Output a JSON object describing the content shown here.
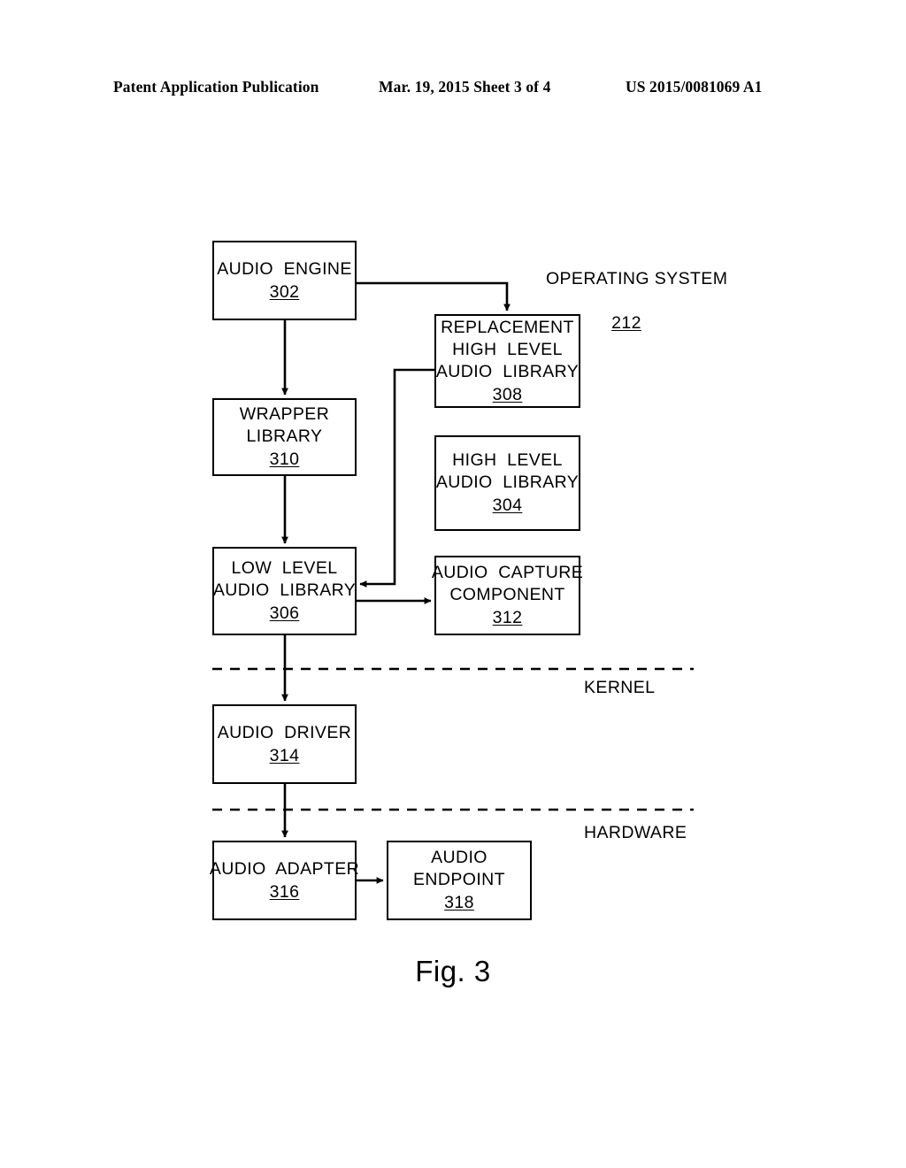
{
  "header": {
    "left": "Patent Application Publication",
    "middle": "Mar. 19, 2015  Sheet 3 of 4",
    "right": "US 2015/0081069 A1"
  },
  "figure": {
    "caption": "Fig. 3"
  },
  "diagram": {
    "operating_system_label": {
      "title": "OPERATING SYSTEM",
      "ref": "212"
    },
    "kernel_label": "KERNEL",
    "hardware_label": "HARDWARE",
    "nodes": [
      {
        "id": "audio-engine",
        "lines": [
          "AUDIO  ENGINE"
        ],
        "ref": "302"
      },
      {
        "id": "replacement-high-level",
        "lines": [
          "REPLACEMENT",
          "HIGH  LEVEL",
          "AUDIO  LIBRARY"
        ],
        "ref": "308"
      },
      {
        "id": "wrapper-library",
        "lines": [
          "WRAPPER",
          "LIBRARY"
        ],
        "ref": "310"
      },
      {
        "id": "high-level-audio",
        "lines": [
          "HIGH  LEVEL",
          "AUDIO  LIBRARY"
        ],
        "ref": "304"
      },
      {
        "id": "low-level-audio",
        "lines": [
          "LOW  LEVEL",
          "AUDIO  LIBRARY"
        ],
        "ref": "306"
      },
      {
        "id": "audio-capture",
        "lines": [
          "AUDIO  CAPTURE",
          "COMPONENT"
        ],
        "ref": "312"
      },
      {
        "id": "audio-driver",
        "lines": [
          "AUDIO  DRIVER"
        ],
        "ref": "314"
      },
      {
        "id": "audio-adapter",
        "lines": [
          "AUDIO  ADAPTER"
        ],
        "ref": "316"
      },
      {
        "id": "audio-endpoint",
        "lines": [
          "AUDIO",
          "ENDPOINT"
        ],
        "ref": "318"
      }
    ],
    "colors": {
      "stroke": "#000000",
      "background": "#ffffff"
    }
  }
}
